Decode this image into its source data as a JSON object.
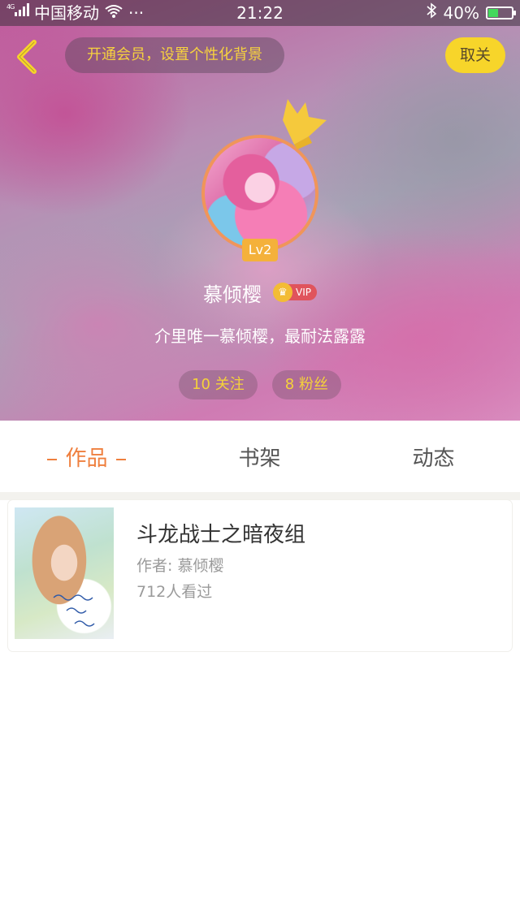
{
  "status_bar": {
    "network": "4G",
    "carrier": "中国移动",
    "more": "···",
    "time": "21:22",
    "battery_text": "40%",
    "battery_level": 0.4
  },
  "header": {
    "vip_banner": "开通会员，设置个性化背景",
    "cancel_label": "取关"
  },
  "profile": {
    "level": "Lv2",
    "username": "慕倾樱",
    "vip_label": "VIP",
    "bio": "介里唯一慕倾樱，最耐法露露",
    "following": "10 关注",
    "followers": "8 粉丝"
  },
  "tabs": [
    {
      "label": "作品",
      "active": true
    },
    {
      "label": "书架",
      "active": false
    },
    {
      "label": "动态",
      "active": false
    }
  ],
  "works": [
    {
      "title": "斗龙战士之暗夜组",
      "author": "作者: 慕倾樱",
      "views": "712人看过"
    }
  ],
  "colors": {
    "accent": "#ef7f3e",
    "vip_yellow": "#f7d52a",
    "level_badge": "#f4b13b",
    "stat_text": "#f5d23a"
  }
}
